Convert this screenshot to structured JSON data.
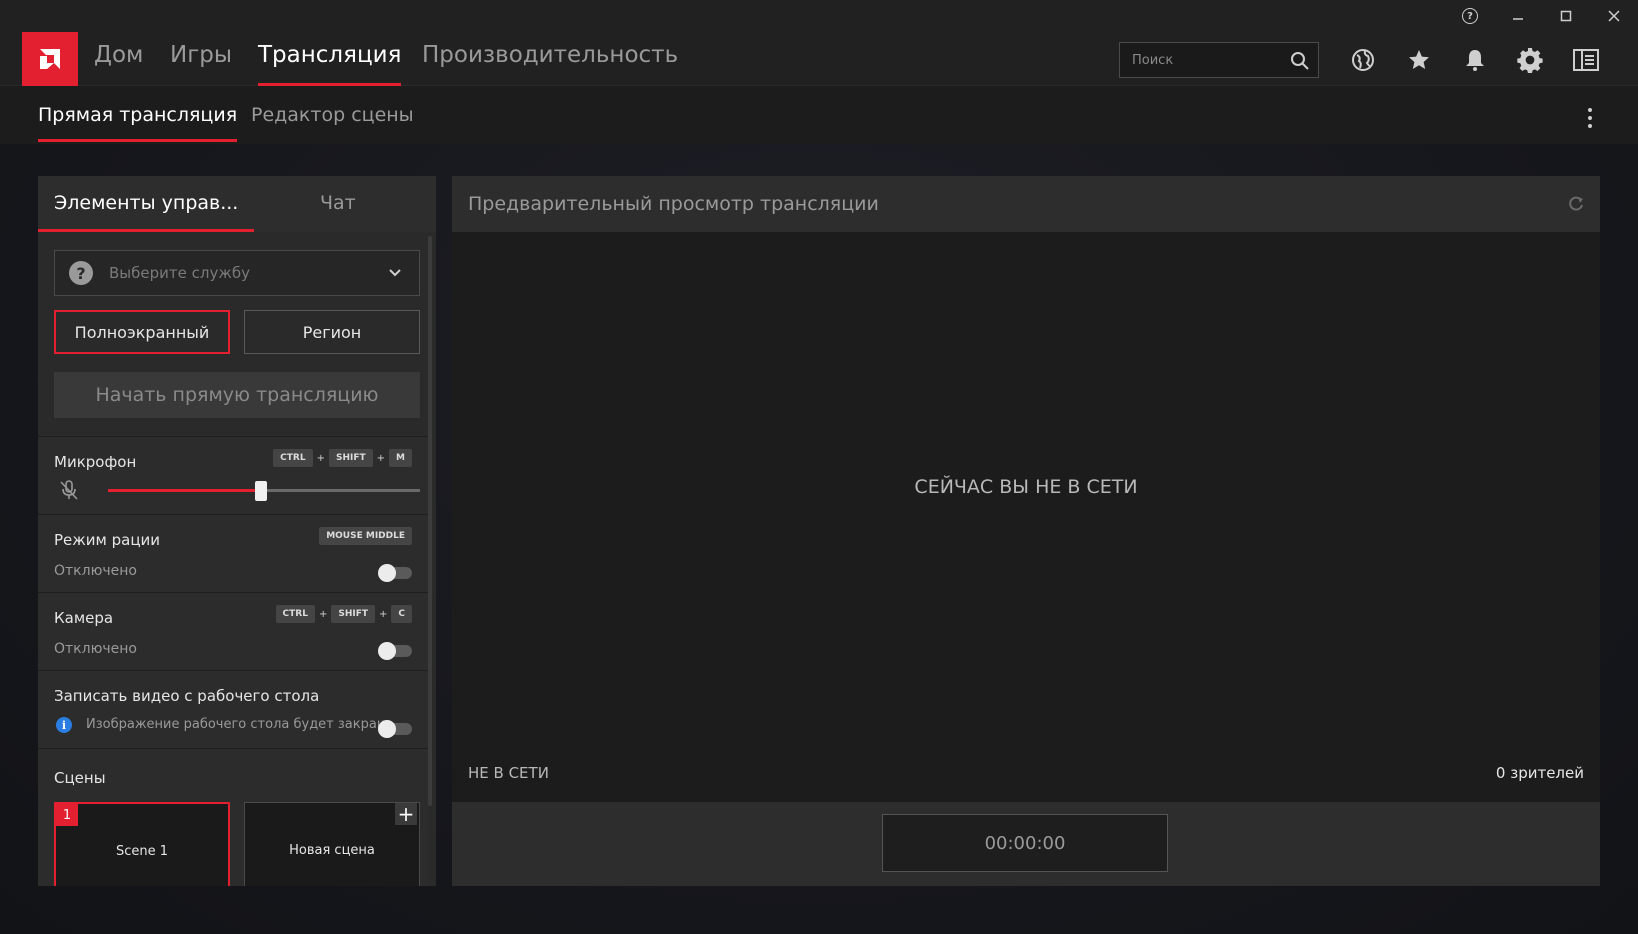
{
  "nav": {
    "items": [
      "Дом",
      "Игры",
      "Трансляция",
      "Производительность"
    ],
    "active": "Трансляция"
  },
  "search": {
    "placeholder": "Поиск"
  },
  "subnav": {
    "items": [
      "Прямая трансляция",
      "Редактор сцены"
    ],
    "active": "Прямая трансляция"
  },
  "left_panel": {
    "tabs": [
      "Элементы управ...",
      "Чат"
    ],
    "service_placeholder": "Выберите службу",
    "mode_fullscreen": "Полноэкранный",
    "mode_region": "Регион",
    "start_button": "Начать прямую трансляцию",
    "microphone": {
      "title": "Микрофон",
      "hotkeys": [
        "CTRL",
        "SHIFT",
        "M"
      ],
      "level_percent": 49
    },
    "radio_mode": {
      "title": "Режим рации",
      "hotkey": "MOUSE MIDDLE",
      "status": "Отключено"
    },
    "camera": {
      "title": "Камера",
      "hotkeys": [
        "CTRL",
        "SHIFT",
        "C"
      ],
      "status": "Отключено"
    },
    "desktop": {
      "title": "Записать видео с рабочего стола",
      "info": "Изображение рабочего стола будет закраш..."
    },
    "scenes": {
      "title": "Сцены",
      "items": [
        {
          "number": "1",
          "name": "Scene 1"
        }
      ],
      "new_scene": "Новая сцена"
    }
  },
  "preview": {
    "title": "Предварительный просмотр трансляции",
    "offline_message": "СЕЙЧАС ВЫ НЕ В СЕТИ",
    "status": "НЕ В СЕТИ",
    "viewers": "0 зрителей",
    "timer": "00:00:00"
  },
  "colors": {
    "accent": "#e2202f",
    "info": "#2a7de1"
  }
}
